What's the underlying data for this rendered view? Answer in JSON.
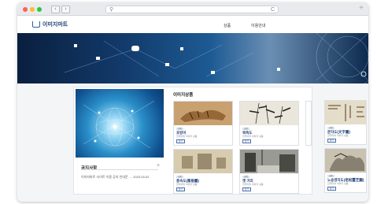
{
  "browser": {
    "back_label": "‹",
    "forward_label": "›",
    "search_icon": "search-icon",
    "reload_label": "C",
    "newtab_label": "+"
  },
  "header": {
    "logo_text": "이미지마트",
    "nav": [
      "상품",
      "이용안내"
    ]
  },
  "notice": {
    "title": "공지사항",
    "more": "+",
    "item": "이미지마트 사이트 이용 공지 안내문 ....  2023.03.02"
  },
  "gallery": {
    "title": "이미지상품",
    "items": [
      {
        "tag": "상품",
        "title": "호랑이",
        "sub": "한국미술 이미지 상품",
        "button": "보기",
        "kind": "tiger"
      },
      {
        "tag": "상품",
        "title": "묵죽도",
        "sub": "한국미술 이미지 상품",
        "button": "보기",
        "kind": "bamboo"
      },
      {
        "tag": "상품",
        "title": "문자도(文字圖)",
        "sub": "한국미술 이미지 상품",
        "button": "보기",
        "kind": "script"
      },
      {
        "tag": "상품",
        "title": "풍속도(風俗圖)",
        "sub": "한국미술 이미지 상품",
        "button": "보기",
        "kind": "genre"
      },
      {
        "tag": "상품",
        "title": "옛 거리",
        "sub": "한국미술 이미지 상품",
        "button": "보기",
        "kind": "street"
      },
      {
        "tag": "상품",
        "title": "노송영지도(老松靈芝圖)",
        "sub": "한국미술 이미지 상품",
        "button": "보기",
        "kind": "pine"
      }
    ]
  },
  "colors": {
    "brand": "#1c3f75",
    "banner": "#123a6a"
  }
}
